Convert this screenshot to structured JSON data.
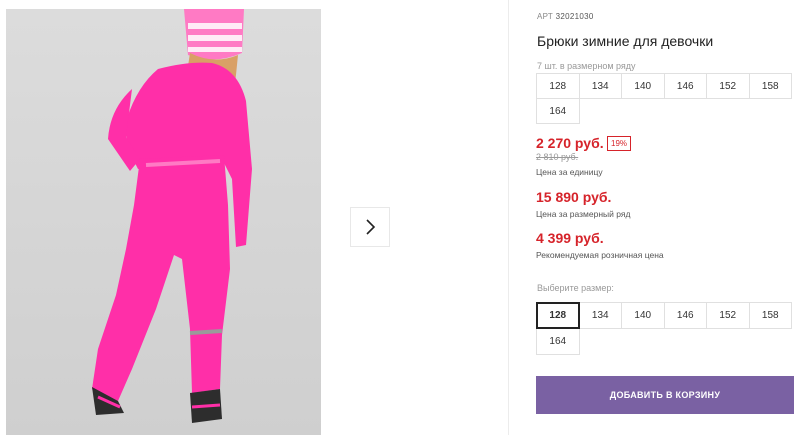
{
  "product": {
    "art_label": "АРТ",
    "art_code": "32021030",
    "title": "Брюки зимние для девочки"
  },
  "size_range": {
    "note": "7 шт. в размерном ряду",
    "sizes": [
      "128",
      "134",
      "140",
      "146",
      "152",
      "158",
      "164"
    ]
  },
  "prices": {
    "unit_price": "2 270 руб.",
    "discount_badge": "19%",
    "old_price": "2 810 руб.",
    "unit_label": "Цена за единицу",
    "range_price": "15 890 руб.",
    "range_label": "Цена за размерный ряд",
    "retail_price": "4 399 руб.",
    "retail_label": "Рекомендуемая розничная цена"
  },
  "size_select": {
    "label": "Выберите размер:",
    "selected": "128",
    "sizes": [
      "128",
      "134",
      "140",
      "146",
      "152",
      "158",
      "164"
    ]
  },
  "cart": {
    "button_label": "ДОБАВИТЬ В КОРЗИНУ"
  },
  "colors": {
    "price_red": "#d6232a",
    "cart_purple": "#7a61a3",
    "pants_pink": "#ff2fa8"
  }
}
